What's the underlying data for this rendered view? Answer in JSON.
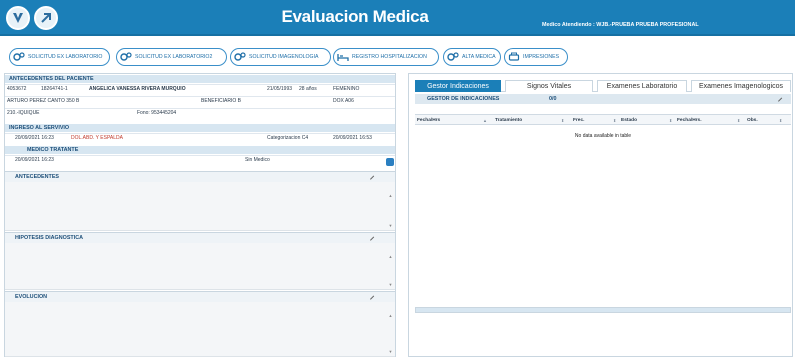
{
  "header": {
    "title": "Evaluacion Medica",
    "medico_label": "Medico Atendiendo : WJB.-PRUEBA PRUEBA PROFESIONAL"
  },
  "actions": [
    {
      "label": "SOLICITUD EX LABORATORIO"
    },
    {
      "label": "SOLICITUD EX LABORATORIO2"
    },
    {
      "label": "SOLICITUD IMAGENOLOGIA"
    },
    {
      "label": "REGISTRO HOSPITALIZACION"
    },
    {
      "label": "ALTA MEDICA"
    },
    {
      "label": "IMPRESIONES"
    }
  ],
  "antecedentes_paciente": {
    "title": "ANTECEDENTES DEL PACIENTE",
    "row1": [
      "4053672",
      "18264741-1",
      "ANGELICA VANESSA RIVERA MURQUIO",
      "21/05/1993",
      "28 años",
      "FEMENINO"
    ],
    "row2": [
      "ARTURO PEREZ CANTO 350 B",
      "BENEFICIARIO B",
      "DOX A06"
    ],
    "row3": [
      "210.-IQUIQUE",
      "Fono: 953445204"
    ]
  },
  "ingreso": {
    "title": "INGRESO AL SERVIVIO",
    "fecha": "20/09/2021 16:23",
    "motivo": "DOL.ABD. Y ESPALDA",
    "categorizacion": "Categorizacion C4",
    "fecha_cat": "20/09/2021 16:53"
  },
  "medico_tratante": {
    "title": "MEDICO TRATANTE",
    "fecha": "20/09/2021 16:23",
    "nombre": "Sin Medico"
  },
  "panels": {
    "antecedentes": "ANTECEDENTES",
    "hipotesis": "HIPOTESIS DIAGNOSTICA",
    "evolucion": "EVOLUCION"
  },
  "tabs": [
    "Gestor Indicaciones",
    "Signos Vitales",
    "Examenes Laboratorio",
    "Examenes Imagenologicos"
  ],
  "gestor": {
    "title": "GESTOR DE INDICACIONES",
    "count": "0/0",
    "columns": [
      "Fecha/Hrs",
      "Tratamiento",
      "Frec.",
      "Estado",
      "Fecha/Hrs.",
      "Obs."
    ],
    "empty": "No data available in table"
  },
  "colors": {
    "header_bg": "#1b7fb8",
    "accent": "#1b7fb8",
    "section_bg": "#d7e6f1",
    "alert_text": "#c0392b"
  }
}
